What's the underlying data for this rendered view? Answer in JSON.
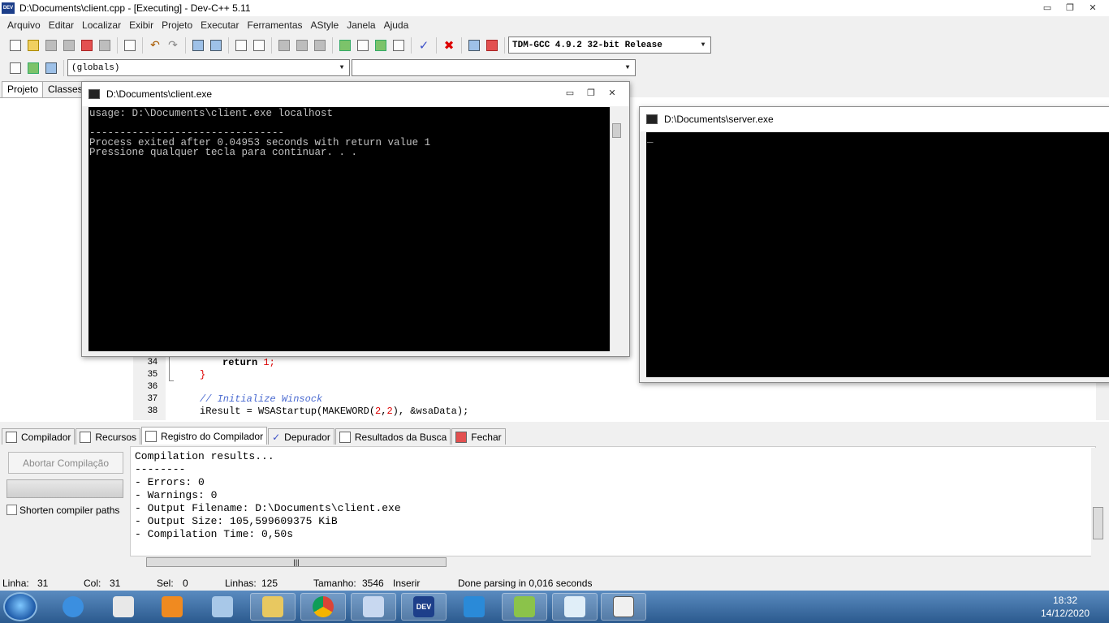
{
  "window": {
    "title": "D:\\Documents\\client.cpp - [Executing] - Dev-C++ 5.11",
    "app_icon_text": "DEV"
  },
  "menu": [
    "Arquivo",
    "Editar",
    "Localizar",
    "Exibir",
    "Projeto",
    "Executar",
    "Ferramentas",
    "AStyle",
    "Janela",
    "Ajuda"
  ],
  "toolbar": {
    "compiler_select": "TDM-GCC 4.9.2 32-bit Release",
    "scope_select": "(globals)",
    "function_select": ""
  },
  "left_tabs": [
    "Projeto",
    "Classes"
  ],
  "editor": {
    "lines": [
      {
        "n": "34",
        "code": "        return 1;"
      },
      {
        "n": "35",
        "code": "    }"
      },
      {
        "n": "36",
        "code": ""
      },
      {
        "n": "37",
        "code": "    // Initialize Winsock"
      },
      {
        "n": "38",
        "code": "    iResult = WSAStartup(MAKEWORD(2,2), &wsaData);"
      }
    ],
    "line34_kw": "return",
    "line34_num": "1",
    "line34_end": ";",
    "line35": "}",
    "line37_comment": "// Initialize Winsock",
    "line38_a": "iResult = WSAStartup(MAKEWORD(",
    "line38_num1": "2",
    "line38_comma": ",",
    "line38_num2": "2",
    "line38_b": "), &wsaData);"
  },
  "client_console": {
    "title": "D:\\Documents\\client.exe",
    "text": "usage: D:\\Documents\\client.exe localhost\n\n--------------------------------\nProcess exited after 0.04953 seconds with return value 1\nPressione qualquer tecla para continuar. . ."
  },
  "server_console": {
    "title": "D:\\Documents\\server.exe",
    "text": "_"
  },
  "bottom_tabs": [
    "Compilador",
    "Recursos",
    "Registro do Compilador",
    "Depurador",
    "Resultados da Busca",
    "Fechar"
  ],
  "bottom_panel": {
    "abort_label": "Abortar Compilação",
    "shorten_label": "Shorten compiler paths",
    "log": [
      "Compilation results...",
      "--------",
      "- Errors: 0",
      "- Warnings: 0",
      "- Output Filename: D:\\Documents\\client.exe",
      "- Output Size: 105,599609375 KiB",
      "- Compilation Time: 0,50s"
    ]
  },
  "status": {
    "linha_label": "Linha:",
    "linha": "31",
    "col_label": "Col:",
    "col": "31",
    "sel_label": "Sel:",
    "sel": "0",
    "linhas_label": "Linhas:",
    "linhas": "125",
    "tamanho_label": "Tamanho:",
    "tamanho": "3546",
    "mode": "Inserir",
    "message": "Done parsing in 0,016 seconds"
  },
  "taskbar": {
    "time": "18:32",
    "date": "14/12/2020",
    "dev_label": "DEV"
  },
  "colors": {
    "taskbar": "#2b5a8e",
    "console_bg": "#000000",
    "console_text": "#c0c0c0",
    "keyword_number": "#dd0000",
    "comment": "#4a6ad0"
  }
}
